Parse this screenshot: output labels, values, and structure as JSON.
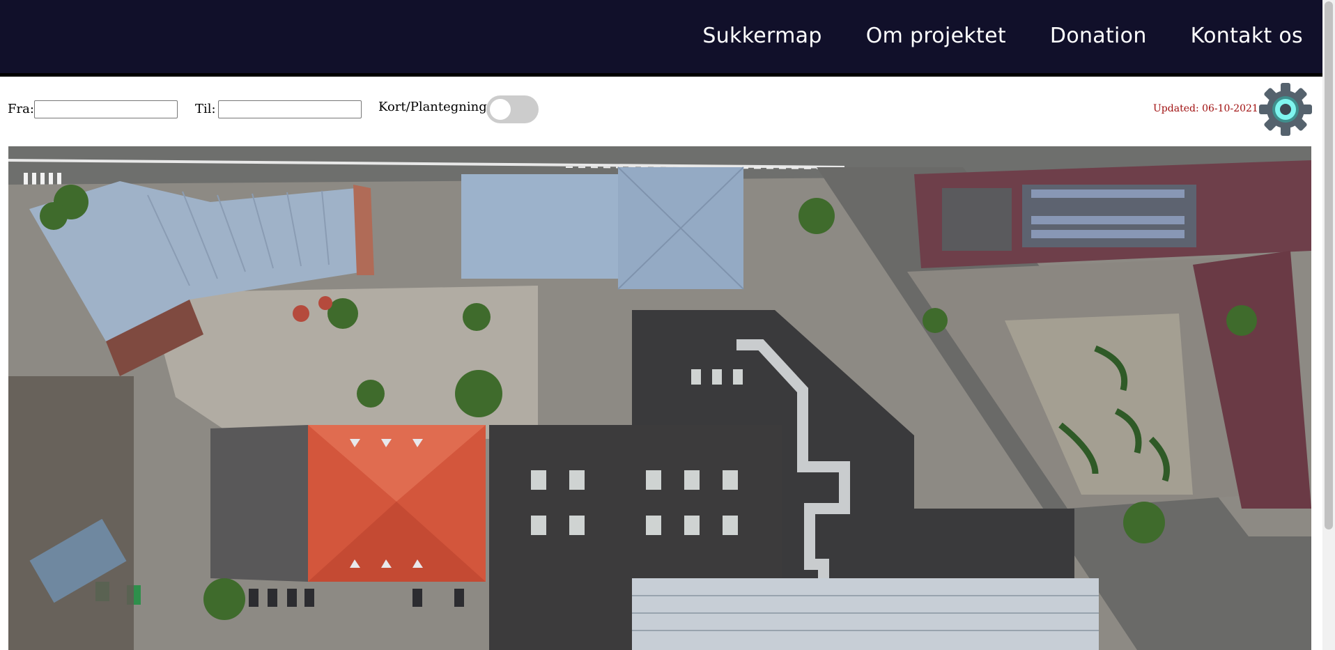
{
  "nav": {
    "items": [
      "Sukkermap",
      "Om projektet",
      "Donation",
      "Kontakt os"
    ]
  },
  "filters": {
    "from_label": "Fra:",
    "from_value": "",
    "to_label": "Til:",
    "to_value": "",
    "toggle_label": "Kort/Plantegning:",
    "toggle_on": false
  },
  "status": {
    "updated_text": "Updated: 06-10-2021",
    "updated_color": "#a01010"
  },
  "settings": {
    "icon": "gear-icon",
    "accent": "#7ff5ef"
  },
  "map": {
    "view": "satellite"
  },
  "colors": {
    "nav_bg": "#11102a",
    "nav_text": "#ffffff"
  }
}
